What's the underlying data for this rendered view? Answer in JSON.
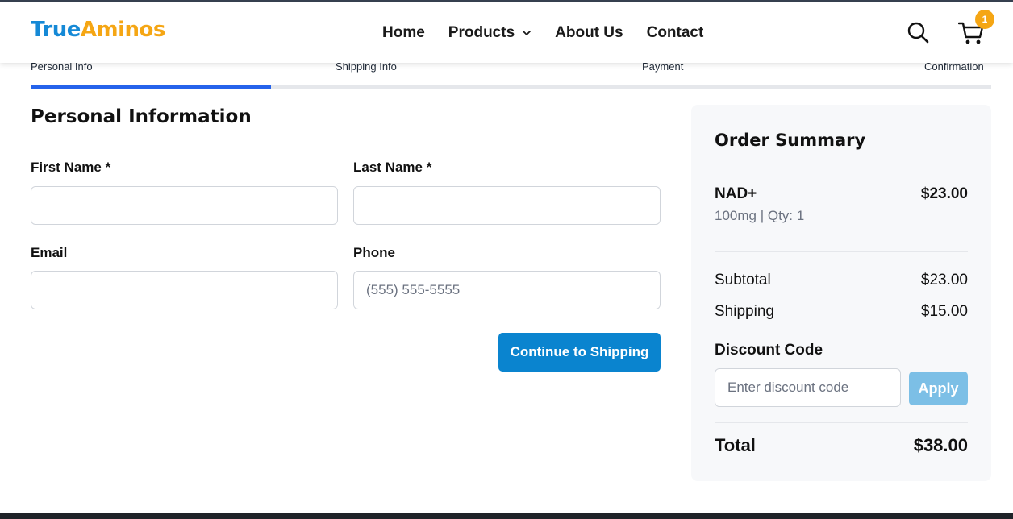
{
  "brand": {
    "part1": "True",
    "part2": "Aminos"
  },
  "nav": {
    "home": "Home",
    "products": "Products",
    "about": "About Us",
    "contact": "Contact"
  },
  "cart": {
    "count": "1"
  },
  "steps": {
    "personal": "Personal Info",
    "shipping": "Shipping Info",
    "payment": "Payment",
    "confirmation": "Confirmation",
    "progress_fraction": 0.25
  },
  "form": {
    "title": "Personal Information",
    "first_name_label": "First Name *",
    "first_name_value": "",
    "last_name_label": "Last Name *",
    "last_name_value": "",
    "email_label": "Email",
    "email_value": "",
    "phone_label": "Phone",
    "phone_placeholder": "(555) 555-5555",
    "continue_label": "Continue to Shipping"
  },
  "summary": {
    "title": "Order Summary",
    "item_name": "NAD+",
    "item_price": "$23.00",
    "item_detail": "100mg | Qty: 1",
    "subtotal_label": "Subtotal",
    "subtotal_value": "$23.00",
    "shipping_label": "Shipping",
    "shipping_value": "$15.00",
    "discount_label": "Discount Code",
    "discount_placeholder": "Enter discount code",
    "apply_label": "Apply",
    "total_label": "Total",
    "total_value": "$38.00"
  },
  "colors": {
    "brand_blue": "#1589d6",
    "brand_orange": "#f5a614",
    "primary_button": "#0a84cf",
    "progress": "#2563eb"
  }
}
